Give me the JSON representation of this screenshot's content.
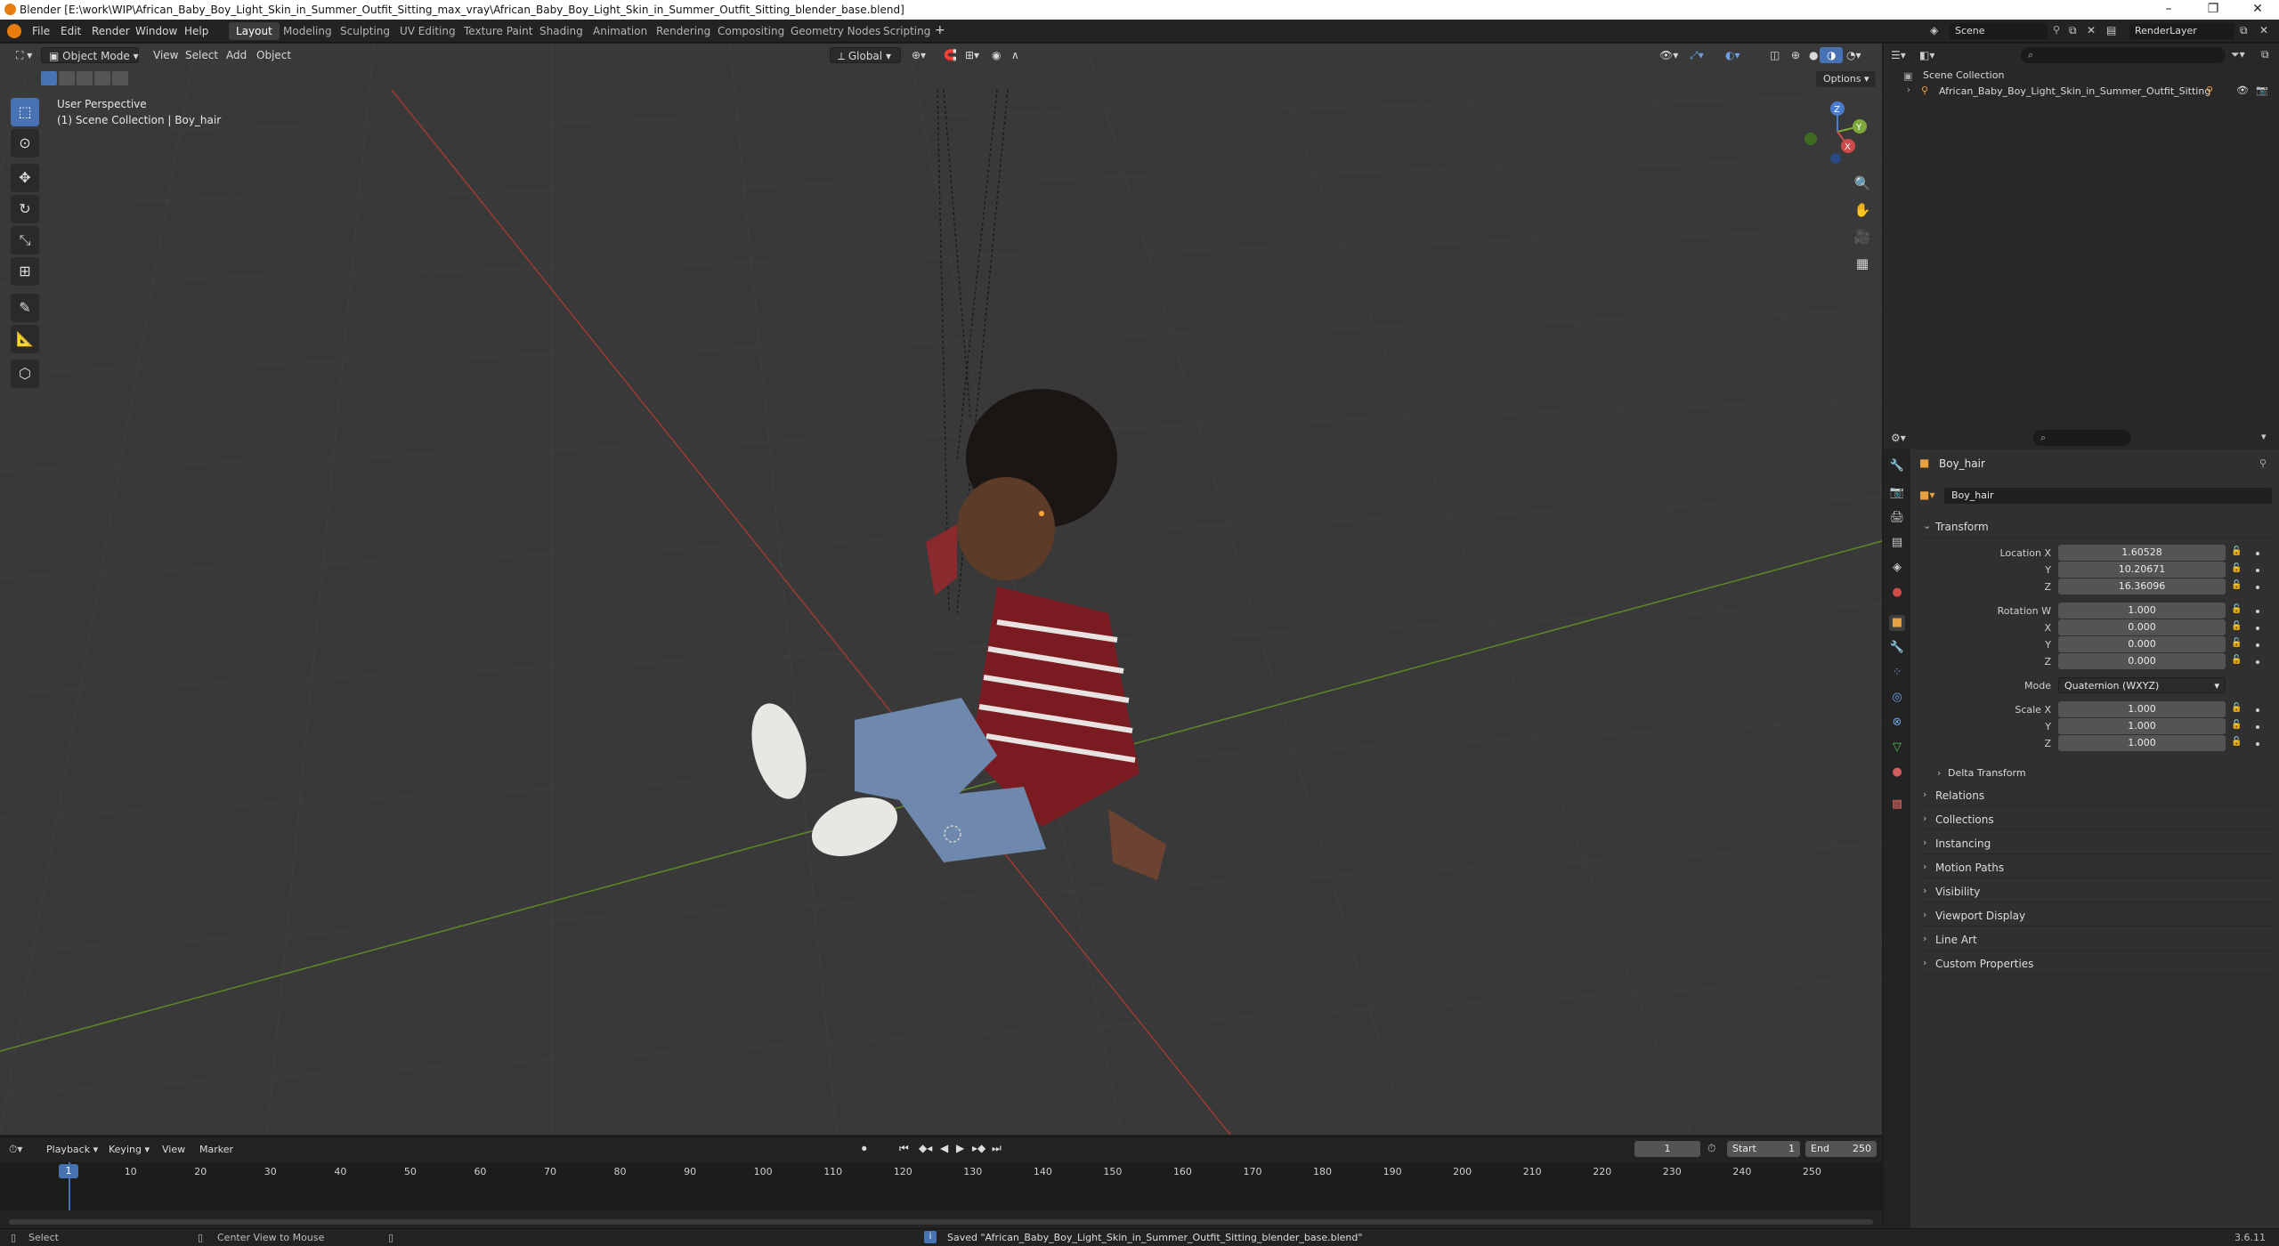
{
  "window": {
    "title": "Blender [E:\\work\\WIP\\African_Baby_Boy_Light_Skin_in_Summer_Outfit_Sitting_max_vray\\African_Baby_Boy_Light_Skin_in_Summer_Outfit_Sitting_blender_base.blend]",
    "minimize": "–",
    "restore": "❐",
    "close": "✕"
  },
  "menu": {
    "items": [
      "File",
      "Edit",
      "Render",
      "Window",
      "Help"
    ],
    "workspaces": [
      "Layout",
      "Modeling",
      "Sculpting",
      "UV Editing",
      "Texture Paint",
      "Shading",
      "Animation",
      "Rendering",
      "Compositing",
      "Geometry Nodes",
      "Scripting"
    ],
    "active_workspace": "Layout",
    "add_workspace": "+",
    "scene": "Scene",
    "view_layer": "RenderLayer"
  },
  "viewport": {
    "mode": "Object Mode",
    "menus": [
      "View",
      "Select",
      "Add",
      "Object"
    ],
    "transform_orientation": "Global",
    "options_label": "Options",
    "overlay_title": "User Perspective",
    "overlay_collection": "(1) Scene Collection | Boy_hair",
    "gizmo_axes": [
      "X",
      "Y",
      "Z"
    ]
  },
  "outliner": {
    "search_placeholder": "",
    "root": "Scene Collection",
    "items": [
      {
        "name": "African_Baby_Boy_Light_Skin_in_Summer_Outfit_Sitting"
      }
    ]
  },
  "properties": {
    "search_placeholder": "",
    "object_name": "Boy_hair",
    "object_name_field": "Boy_hair",
    "transform_header": "Transform",
    "location_label": "Location X",
    "location": {
      "x": "1.60528",
      "y": "10.20671",
      "z": "16.36096"
    },
    "rotation_label": "Rotation W",
    "rotation": {
      "w": "1.000",
      "x": "0.000",
      "y": "0.000",
      "z": "0.000"
    },
    "mode_label": "Mode",
    "mode_value": "Quaternion (WXYZ)",
    "scale_label": "Scale X",
    "scale": {
      "x": "1.000",
      "y": "1.000",
      "z": "1.000"
    },
    "axis_labels": {
      "y": "Y",
      "z": "Z",
      "x": "X"
    },
    "delta_transform": "Delta Transform",
    "panels": [
      "Relations",
      "Collections",
      "Instancing",
      "Motion Paths",
      "Visibility",
      "Viewport Display",
      "Line Art",
      "Custom Properties"
    ]
  },
  "timeline": {
    "menus": [
      "Playback",
      "Keying",
      "View",
      "Marker"
    ],
    "current_frame": "1",
    "start_label": "Start",
    "start": "1",
    "end_label": "End",
    "end": "250",
    "ticks": [
      "1",
      "10",
      "20",
      "30",
      "40",
      "50",
      "60",
      "70",
      "80",
      "90",
      "100",
      "110",
      "120",
      "130",
      "140",
      "150",
      "160",
      "170",
      "180",
      "190",
      "200",
      "210",
      "220",
      "230",
      "240",
      "250"
    ]
  },
  "statusbar": {
    "left_action": "Select",
    "mid_action": "Center View to Mouse",
    "message": "Saved \"African_Baby_Boy_Light_Skin_in_Summer_Outfit_Sitting_blender_base.blend\"",
    "version": "3.6.11"
  },
  "colors": {
    "accent": "#4772b3",
    "x_axis": "#c8483f",
    "y_axis": "#6a9a2a",
    "viewport_bg": "#393939"
  }
}
